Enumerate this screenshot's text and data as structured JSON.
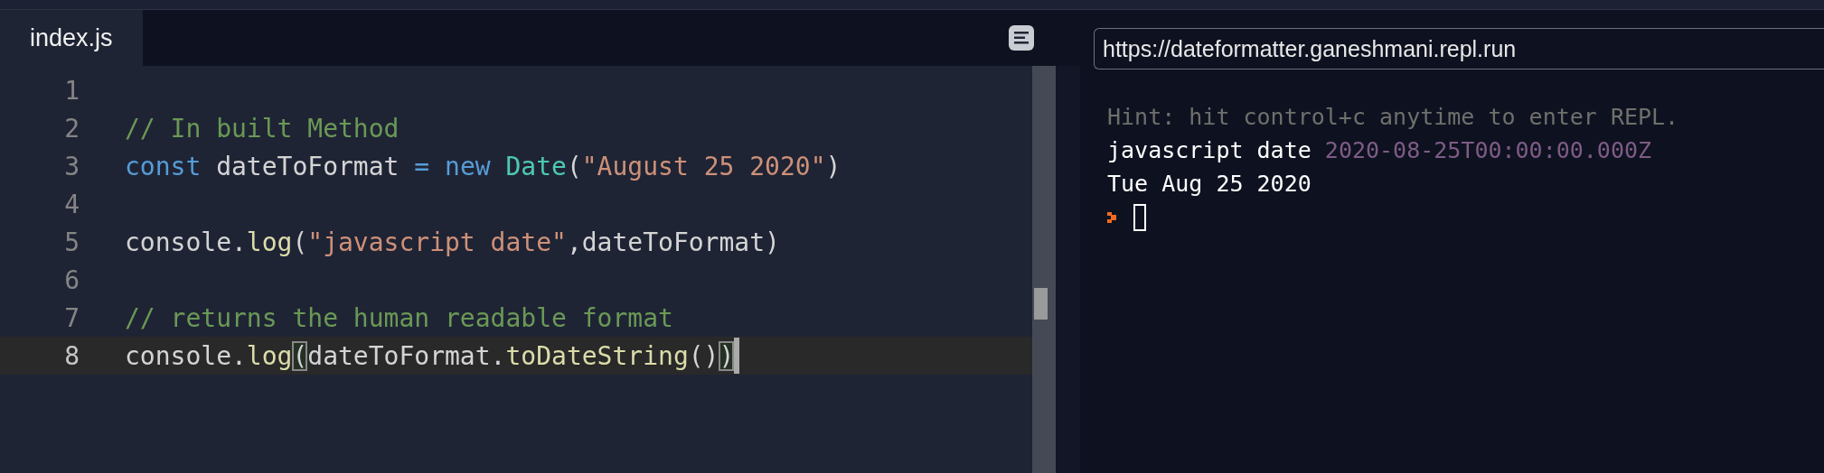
{
  "editor": {
    "tabs": [
      {
        "label": "index.js",
        "selected": true
      }
    ],
    "lines": [
      {
        "number": "1",
        "active": false
      },
      {
        "number": "2",
        "active": false,
        "tokens": [
          {
            "kind": "comment",
            "text": "// In built Method"
          }
        ]
      },
      {
        "number": "3",
        "active": false,
        "tokens": [
          {
            "kind": "keyword",
            "text": "const"
          },
          {
            "kind": "plain",
            "text": " dateToFormat "
          },
          {
            "kind": "keyword",
            "text": "= new "
          },
          {
            "kind": "class",
            "text": "Date"
          },
          {
            "kind": "plain",
            "text": "("
          },
          {
            "kind": "string",
            "text": "\"August 25 2020\""
          },
          {
            "kind": "plain",
            "text": ")"
          }
        ]
      },
      {
        "number": "4",
        "active": false
      },
      {
        "number": "5",
        "active": false,
        "tokens": [
          {
            "kind": "plain",
            "text": "console."
          },
          {
            "kind": "function",
            "text": "log"
          },
          {
            "kind": "plain",
            "text": "("
          },
          {
            "kind": "string",
            "text": "\"javascript date\""
          },
          {
            "kind": "plain",
            "text": ",dateToFormat)"
          }
        ]
      },
      {
        "number": "6",
        "active": false
      },
      {
        "number": "7",
        "active": false,
        "tokens": [
          {
            "kind": "comment",
            "text": "// returns the human readable format"
          }
        ]
      },
      {
        "number": "8",
        "active": true,
        "tokens": [
          {
            "kind": "plain",
            "text": "console."
          },
          {
            "kind": "function",
            "text": "log"
          },
          {
            "kind": "bracket",
            "text": "("
          },
          {
            "kind": "plain",
            "text": "dateToFormat."
          },
          {
            "kind": "function",
            "text": "toDateString"
          },
          {
            "kind": "plain",
            "text": "()"
          },
          {
            "kind": "bracket",
            "text": ")"
          }
        ]
      }
    ]
  },
  "preview": {
    "url": "https://dateformatter.ganeshmani.repl.run",
    "console": [
      {
        "kind": "hint",
        "segments": [
          {
            "kind": "plain",
            "text": "Hint: hit control+c anytime to enter REPL."
          }
        ]
      },
      {
        "kind": "output",
        "segments": [
          {
            "kind": "plain",
            "text": "javascript date "
          },
          {
            "kind": "value",
            "text": "2020-08-25T00:00:00.000Z"
          }
        ]
      },
      {
        "kind": "output",
        "segments": [
          {
            "kind": "plain",
            "text": "Tue Aug 25 2020"
          }
        ]
      },
      {
        "kind": "prompt"
      }
    ]
  }
}
